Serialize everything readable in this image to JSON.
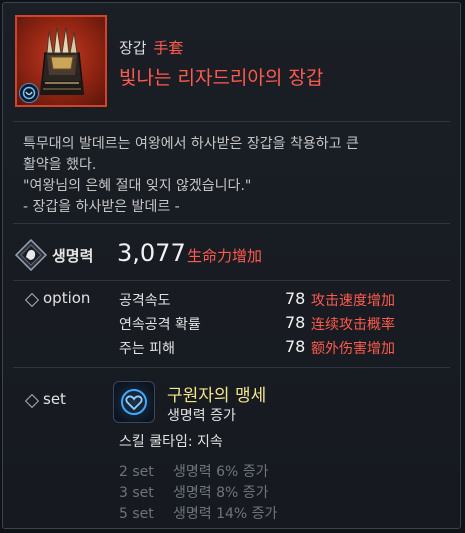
{
  "item": {
    "type_ko": "장갑",
    "type_cn": "手套",
    "name": "빛나는 리자드리아의 장갑",
    "icon": "gauntlet-icon",
    "badge_icon": "blue-emblem-icon",
    "frame_color": "#d0442b"
  },
  "description": [
    "특무대의 발데르는 여왕에서 하사받은 장갑을 착용하고 큰",
    "활약을 했다.",
    "\"여왕님의 은혜 절대 잊지 않겠습니다.\"",
    "- 장갑을 하사받은 발데르 -"
  ],
  "main_stat": {
    "icon": "stat-emblem-icon",
    "label": "생명력",
    "value": "3,077",
    "label_cn": "生命力增加"
  },
  "option": {
    "title": "option",
    "rows": [
      {
        "name": "공격속도",
        "value": "78",
        "cn": "攻击速度增加"
      },
      {
        "name": "연속공격 확률",
        "value": "78",
        "cn": "连续攻击概率"
      },
      {
        "name": "주는 피해",
        "value": "78",
        "cn": "额外伤害增加"
      }
    ]
  },
  "set": {
    "title": "set",
    "icon": "heart-shield-icon",
    "name": "구원자의 맹세",
    "effect": "생명력 증가",
    "cooldown": "스킬 쿨타임: 지속",
    "bonuses": [
      {
        "count": "2 set",
        "text": "생명력 6% 증가"
      },
      {
        "count": "3 set",
        "text": "생명력 8% 증가"
      },
      {
        "count": "5 set",
        "text": "생명력 14% 증가"
      }
    ]
  },
  "colors": {
    "accent_red": "#ff5a4e",
    "set_name": "#f3e58a",
    "inactive": "#6e747c"
  }
}
